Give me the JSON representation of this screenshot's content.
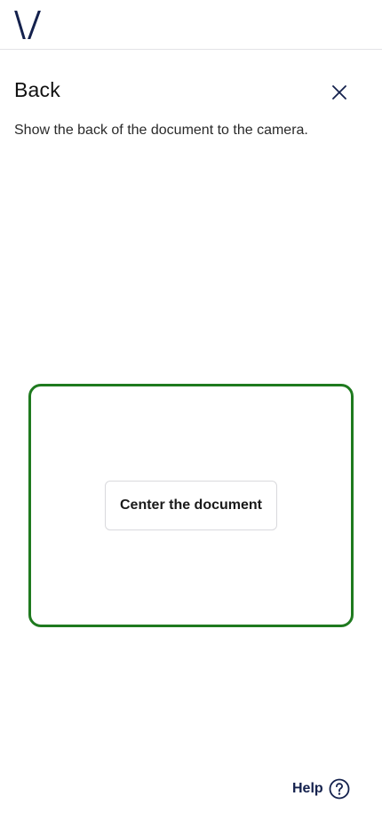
{
  "header": {
    "logo_icon": "brand-v-logo",
    "brand_color": "#14214d"
  },
  "step": {
    "title": "Back",
    "instruction": "Show the back of the document to the camera.",
    "close_icon": "close-icon"
  },
  "camera": {
    "frame_color": "#1f7a1f",
    "hint": "Center the document"
  },
  "footer": {
    "help_label": "Help",
    "help_icon": "question-circle-icon"
  }
}
